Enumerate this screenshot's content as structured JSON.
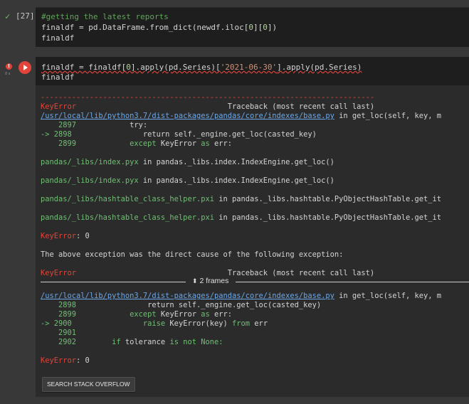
{
  "cell1": {
    "status": "✓",
    "number": "[27]",
    "line1_comment": "#getting the latest reports",
    "line2": {
      "a": "finaldf = pd.DataFrame.from_dict(newdf.iloc[",
      "n1": "0",
      "b": "][",
      "n2": "0",
      "c": "])"
    },
    "line3": "finaldf"
  },
  "cell2": {
    "error_icon": "!",
    "exec_time": "0 s",
    "line1": {
      "a": "finaldf = finaldf[",
      "n1": "0",
      "b": "].apply(pd.Series)[",
      "s": "'2021-06-30'",
      "c": "].apply(pd.Series)"
    },
    "line2": "finaldf"
  },
  "output": {
    "dashes": "---------------------------------------------------------------------------",
    "tb1": {
      "err": "KeyError",
      "spaces": "                                  ",
      "label": "Traceback (most recent call last)"
    },
    "file1": "/usr/local/lib/python3.7/dist-packages/pandas/core/indexes/base.py",
    "file1_rest": " in get_loc(self, key, m",
    "l2897": {
      "n": "    2897",
      "code": "            try:"
    },
    "l2898": {
      "arrow": "-> 2898",
      "code": "                return self._engine.get_loc(casted_key)"
    },
    "l2899": {
      "n": "    2899",
      "kw": "except",
      "mid": " KeyError ",
      "as": "as",
      "end": " err:"
    },
    "pandas1": {
      "path": "pandas/_libs/index.pyx",
      "rest": " in pandas._libs.index.IndexEngine.get_loc()"
    },
    "pandas2": {
      "path": "pandas/_libs/index.pyx",
      "rest": " in pandas._libs.index.IndexEngine.get_loc()"
    },
    "pandas3": {
      "path": "pandas/_libs/hashtable_class_helper.pxi",
      "rest": " in pandas._libs.hashtable.PyObjectHashTable.get_it"
    },
    "pandas4": {
      "path": "pandas/_libs/hashtable_class_helper.pxi",
      "rest": " in pandas._libs.hashtable.PyObjectHashTable.get_it"
    },
    "keyerr1": {
      "err": "KeyError",
      "rest": ": 0"
    },
    "cause": "The above exception was the direct cause of the following exception:",
    "tb2": {
      "err": "KeyError",
      "spaces": "                                  ",
      "label": "Traceback (most recent call last)"
    },
    "frames": "2 frames",
    "file2": "/usr/local/lib/python3.7/dist-packages/pandas/core/indexes/base.py",
    "file2_rest": " in get_loc(self, key, m",
    "m2898": {
      "n": "    2898",
      "code": "                return self._engine.get_loc(casted_key)"
    },
    "m2899": {
      "n": "    2899",
      "kw": "except",
      "mid": " KeyError ",
      "as": "as",
      "end": " err:"
    },
    "m2900": {
      "arrow": "-> 2900",
      "raise": "raise",
      "mid": " KeyError(key) ",
      "from": "from",
      "end": " err"
    },
    "m2901": {
      "n": "    2901"
    },
    "m2902": {
      "n": "    2902",
      "kw": "if",
      "mid": " tolerance ",
      "isnot": "is not",
      "none": " None:"
    },
    "keyerr2": {
      "err": "KeyError",
      "rest": ": 0"
    },
    "so_button": "SEARCH STACK OVERFLOW"
  }
}
